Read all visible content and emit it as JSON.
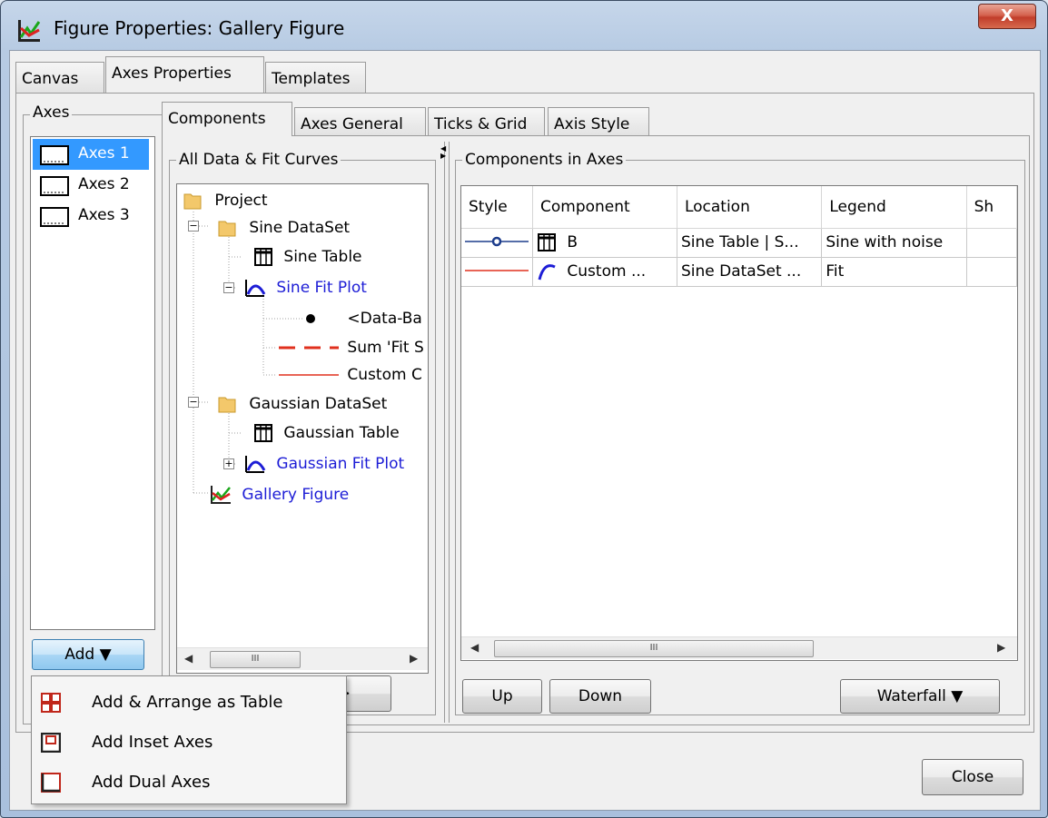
{
  "window": {
    "title": "Figure Properties: Gallery Figure",
    "close_glyph": "X"
  },
  "main_tabs": [
    "Canvas",
    "Axes Properties",
    "Templates"
  ],
  "axes_group": {
    "label": "Axes",
    "items": [
      "Axes 1",
      "Axes 2",
      "Axes 3"
    ],
    "selected": "Axes 1",
    "add_button": "Add ▼"
  },
  "sub_tabs": [
    "Components",
    "Axes General",
    "Ticks & Grid",
    "Axis Style"
  ],
  "curves_group": {
    "label": "All Data & Fit Curves",
    "tree": {
      "project": "Project",
      "sine_dataset": "Sine DataSet",
      "sine_table": "Sine Table",
      "sine_fit_plot": "Sine Fit Plot",
      "data_ba": "<Data-Ba",
      "sum_fit": "Sum 'Fit S",
      "custom_c": "Custom C",
      "gaussian_dataset": "Gaussian DataSet",
      "gaussian_table": "Gaussian Table",
      "gaussian_fit_plot": "Gaussian Fit Plot",
      "gallery_figure": "Gallery Figure"
    },
    "scroll_thumb": "III",
    "add_arrow_button": ">"
  },
  "components_group": {
    "label": "Components in Axes",
    "columns": [
      "Style",
      "Component",
      "Location",
      "Legend",
      "Sh"
    ],
    "rows": [
      {
        "component": "B",
        "location": "Sine Table | S...",
        "legend": "Sine with noise"
      },
      {
        "component": "Custom ...",
        "location": "Sine DataSet ...",
        "legend": "Fit"
      }
    ],
    "scroll_thumb": "III",
    "up_button": "Up",
    "down_button": "Down",
    "waterfall_button": "Waterfall ▼"
  },
  "footer": {
    "close_button": "Close"
  },
  "popup_menu": {
    "items": [
      "Add & Arrange as Table",
      "Add Inset Axes",
      "Add Dual Axes"
    ]
  },
  "colors": {
    "selection": "#3399ff",
    "link_blue": "#1d1dd6",
    "fit_red": "#e0301e"
  }
}
